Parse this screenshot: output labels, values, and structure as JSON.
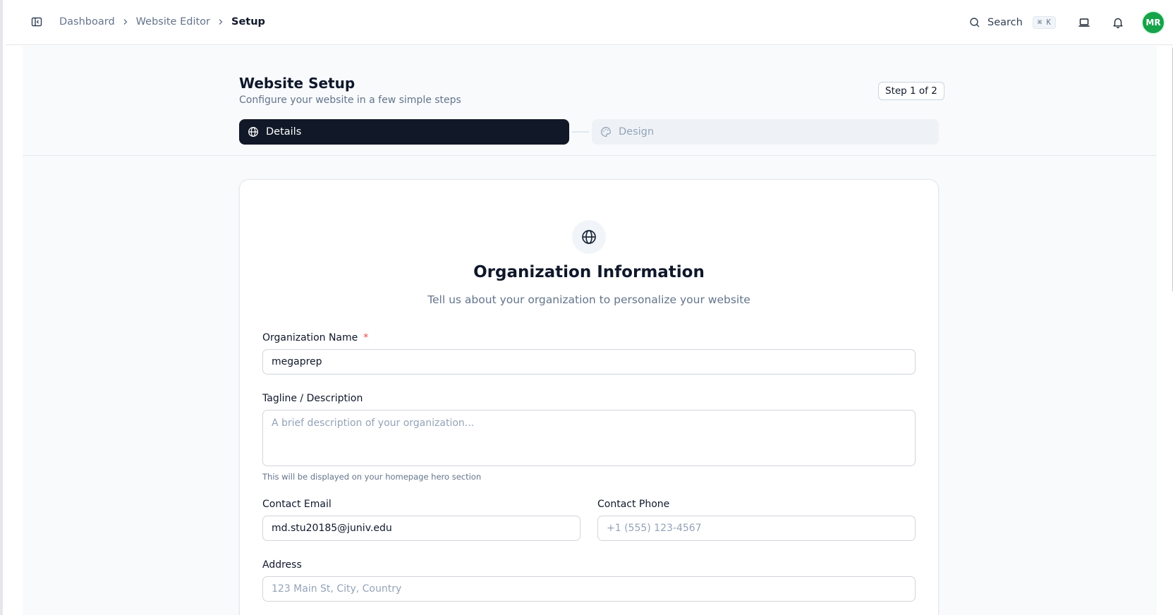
{
  "breadcrumb": {
    "items": [
      {
        "label": "Dashboard"
      },
      {
        "label": "Website Editor"
      },
      {
        "label": "Setup"
      }
    ]
  },
  "topbar": {
    "search_label": "Search",
    "search_shortcut": "⌘ K",
    "avatar_initials": "MR",
    "avatar_color": "#16a34a"
  },
  "page": {
    "title": "Website Setup",
    "subtitle": "Configure your website in a few simple steps",
    "step_badge": "Step 1 of 2"
  },
  "steps": [
    {
      "label": "Details",
      "icon": "globe-icon",
      "active": true
    },
    {
      "label": "Design",
      "icon": "palette-icon",
      "active": false
    }
  ],
  "card": {
    "icon": "globe-icon",
    "title": "Organization Information",
    "subtitle": "Tell us about your organization to personalize your website"
  },
  "form": {
    "org_name": {
      "label": "Organization Name",
      "required_mark": "*",
      "value": "megaprep"
    },
    "tagline": {
      "label": "Tagline / Description",
      "value": "",
      "placeholder": "A brief description of your organization...",
      "hint": "This will be displayed on your homepage hero section"
    },
    "email": {
      "label": "Contact Email",
      "value": "md.stu20185@juniv.edu"
    },
    "phone": {
      "label": "Contact Phone",
      "value": "",
      "placeholder": "+1 (555) 123-4567"
    },
    "address": {
      "label": "Address",
      "value": "",
      "placeholder": "123 Main St, City, Country"
    }
  },
  "colors": {
    "active_tab": "#111827",
    "inactive_tab": "#eef2f6",
    "required": "#ef4444"
  }
}
